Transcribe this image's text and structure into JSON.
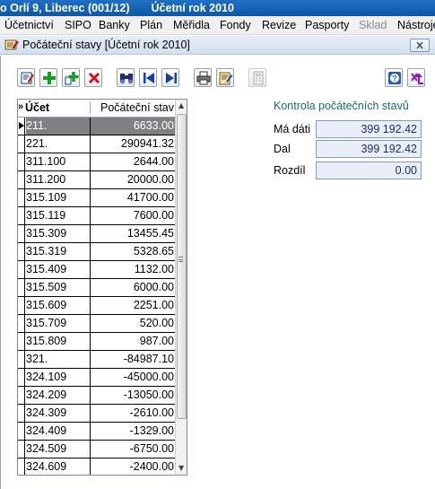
{
  "app": {
    "title_part1": "o Orlí 9, Liberec (001/12)",
    "title_part2": "Účetní rok 2010"
  },
  "menu": [
    {
      "label": "Účetnictví",
      "disabled": false
    },
    {
      "label": "SIPO",
      "disabled": false
    },
    {
      "label": "Banky",
      "disabled": false
    },
    {
      "label": "Plán",
      "disabled": false
    },
    {
      "label": "Měřidla",
      "disabled": false
    },
    {
      "label": "Fondy",
      "disabled": false
    },
    {
      "label": "Revize",
      "disabled": false
    },
    {
      "label": "Pasporty",
      "disabled": false
    },
    {
      "label": "Sklad",
      "disabled": true
    },
    {
      "label": "Nástroje",
      "disabled": false
    }
  ],
  "child_window": {
    "title": "Počáteční stavy  [Účetní rok 2010]"
  },
  "toolbar": [
    {
      "name": "edit-icon"
    },
    {
      "name": "add-icon"
    },
    {
      "name": "add-copy-icon"
    },
    {
      "name": "delete-icon"
    },
    {
      "name": "binoculars-icon"
    },
    {
      "name": "first-record-icon"
    },
    {
      "name": "last-record-icon"
    },
    {
      "name": "printer-icon"
    },
    {
      "name": "notepad-icon"
    },
    {
      "name": "calculator-icon"
    },
    {
      "name": "help-icon"
    },
    {
      "name": "exit-icon"
    }
  ],
  "grid": {
    "sort_mark": "»",
    "columns": [
      "Účet",
      "Počáteční stav"
    ],
    "rows": [
      {
        "account": "211.",
        "value": "6633.00",
        "selected": true
      },
      {
        "account": "221.",
        "value": "290941.32"
      },
      {
        "account": "311.100",
        "value": "2644.00"
      },
      {
        "account": "311.200",
        "value": "20000.00"
      },
      {
        "account": "315.109",
        "value": "41700.00"
      },
      {
        "account": "315.119",
        "value": "7600.00"
      },
      {
        "account": "315.309",
        "value": "13455.45"
      },
      {
        "account": "315.319",
        "value": "5328.65"
      },
      {
        "account": "315.409",
        "value": "1132.00"
      },
      {
        "account": "315.509",
        "value": "6000.00"
      },
      {
        "account": "315.609",
        "value": "2251.00"
      },
      {
        "account": "315.709",
        "value": "520.00"
      },
      {
        "account": "315.809",
        "value": "987.00"
      },
      {
        "account": "321.",
        "value": "-84987.10"
      },
      {
        "account": "324.109",
        "value": "-45000.00"
      },
      {
        "account": "324.209",
        "value": "-13050.00"
      },
      {
        "account": "324.309",
        "value": "-2610.00"
      },
      {
        "account": "324.409",
        "value": "-1329.00"
      },
      {
        "account": "324.509",
        "value": "-6750.00"
      },
      {
        "account": "324.609",
        "value": "-2400.00"
      }
    ]
  },
  "control": {
    "title": "Kontrola počátečních stavů",
    "debit_label": "Má dáti",
    "debit_value": "399 192.42",
    "credit_label": "Dal",
    "credit_value": "399 192.42",
    "diff_label": "Rozdíl",
    "diff_value": "0.00"
  }
}
